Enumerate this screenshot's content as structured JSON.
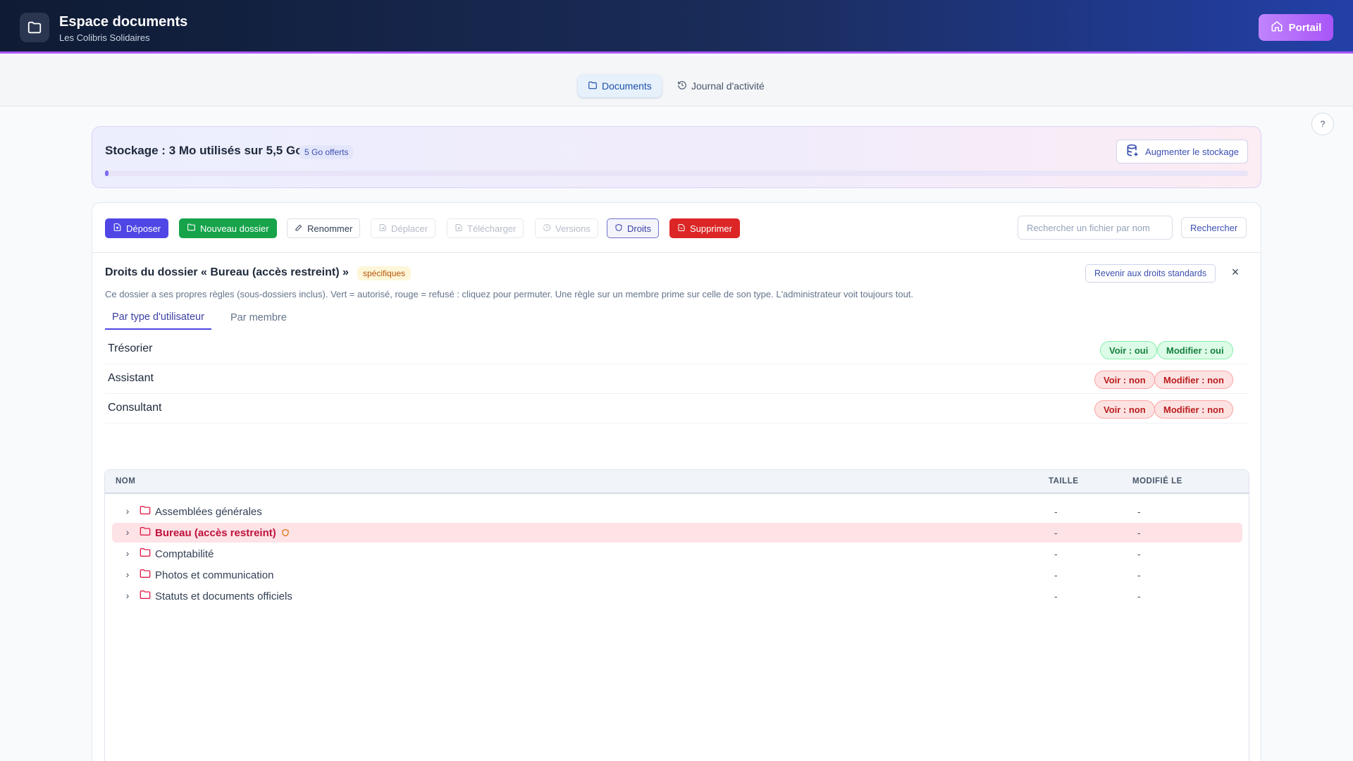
{
  "header": {
    "title": "Espace documents",
    "subtitle": "Les Colibris Solidaires",
    "portal_label": "Portail",
    "folder_icon": "folder-icon",
    "portal_icon": "home-icon"
  },
  "nav": {
    "tabs": [
      {
        "label": "Documents",
        "icon": "folder-icon",
        "active": true
      },
      {
        "label": "Journal d'activité",
        "icon": "history-icon",
        "active": false
      }
    ],
    "help_label": "?"
  },
  "storage": {
    "title": "Stockage : 3 Mo utilisés sur 5,5 Go",
    "badge": "5 Go offerts",
    "button_label": "Augmenter le stockage",
    "used_fraction": 0.0005,
    "button_icon": "database-plus-icon"
  },
  "toolbar": {
    "upload_label": "Déposer",
    "new_folder_label": "Nouveau dossier",
    "rename_label": "Renommer",
    "move_label": "Déplacer",
    "download_label": "Télécharger",
    "versions_label": "Versions",
    "rights_label": "Droits",
    "delete_label": "Supprimer",
    "search_placeholder": "Rechercher un fichier par nom",
    "search_button": "Rechercher"
  },
  "rights": {
    "title": "Droits du dossier « Bureau (accès restreint) »",
    "badge": "spécifiques",
    "revert_label": "Revenir aux droits standards",
    "close_label": "×",
    "description": "Ce dossier a ses propres règles (sous-dossiers inclus). Vert = autorisé, rouge = refusé : cliquez pour permuter. Une règle sur un membre prime sur celle de son type. L'administrateur voit toujours tout.",
    "tabs": [
      "Par type d'utilisateur",
      "Par membre"
    ],
    "rows": [
      {
        "name": "Trésorier",
        "view": "Voir : oui",
        "edit": "Modifier : oui",
        "view_ok": true,
        "edit_ok": true
      },
      {
        "name": "Assistant",
        "view": "Voir : non",
        "edit": "Modifier : non",
        "view_ok": false,
        "edit_ok": false
      },
      {
        "name": "Consultant",
        "view": "Voir : non",
        "edit": "Modifier : non",
        "view_ok": false,
        "edit_ok": false
      }
    ]
  },
  "table": {
    "headers": [
      "NOM",
      "TAILLE",
      "MODIFIÉ LE"
    ],
    "rows": [
      {
        "name": "Assemblées générales",
        "size": "-",
        "date": "-",
        "selected": false
      },
      {
        "name": "Bureau (accès restreint)",
        "size": "-",
        "date": "-",
        "selected": true,
        "restricted": true
      },
      {
        "name": "Comptabilité",
        "size": "-",
        "date": "-",
        "selected": false
      },
      {
        "name": "Photos et communication",
        "size": "-",
        "date": "-",
        "selected": false
      },
      {
        "name": "Statuts et documents officiels",
        "size": "-",
        "date": "-",
        "selected": false
      }
    ]
  },
  "colors": {
    "accent": "#4f46e5",
    "success": "#16a34a",
    "danger": "#dc2626",
    "header_bg": "#0f1b33",
    "selected_row": "#fde2e6"
  }
}
